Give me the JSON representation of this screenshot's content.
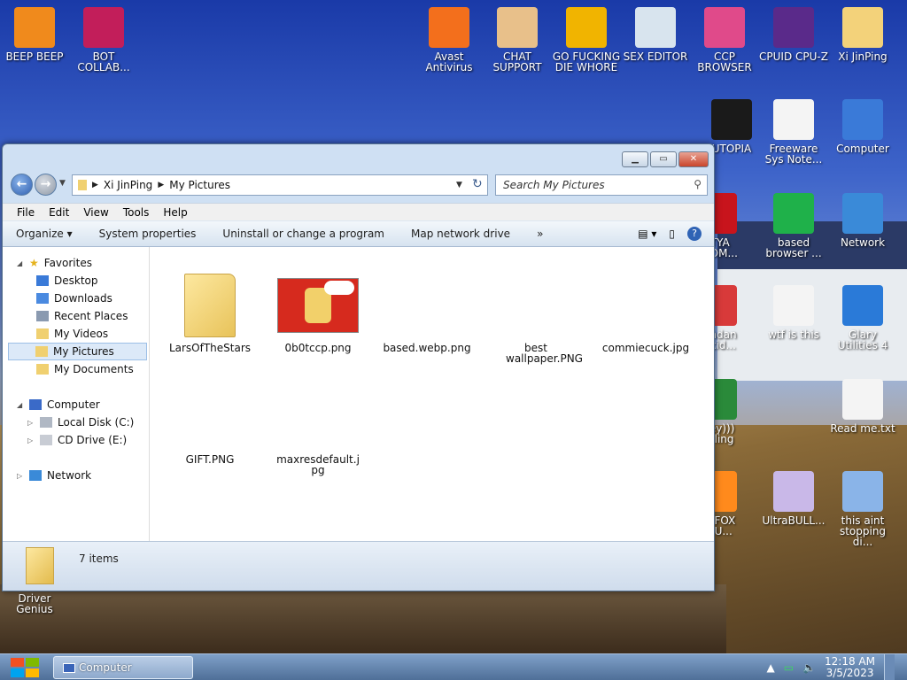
{
  "desktop": {
    "icons": [
      {
        "label": "BEEP BEEP",
        "icon": "vlc-cone-icon",
        "color": "#f08a1c"
      },
      {
        "label": "BOT COLLAB...",
        "icon": "monitor-app-icon",
        "color": "#c21e5a"
      },
      {
        "label": "Avast Antivirus",
        "icon": "avast-icon",
        "color": "#f36f1c"
      },
      {
        "label": "CHAT SUPPORT",
        "icon": "support-person-icon",
        "color": "#e8c08a"
      },
      {
        "label": "GO FUCKING DIE WHORE",
        "icon": "de-logo-icon",
        "color": "#f1b400"
      },
      {
        "label": "SEX EDITOR",
        "icon": "hex-editor-icon",
        "color": "#d8e4ee"
      },
      {
        "label": "CCP BROWSER",
        "icon": "browser-orb-icon",
        "color": "#e04a8a"
      },
      {
        "label": "CPUID CPU-Z",
        "icon": "cpuz-icon",
        "color": "#5a2a8a"
      },
      {
        "label": "Xi JinPing",
        "icon": "user-folder-icon",
        "color": "#f3d27a"
      },
      {
        "label": "UTOPIA",
        "icon": "utopia-icon",
        "color": "#1a1a1a"
      },
      {
        "label": "Freeware Sys Note...",
        "icon": "document-icon",
        "color": "#f4f4f4"
      },
      {
        "label": "Computer",
        "icon": "computer-icon",
        "color": "#3a7ad8"
      },
      {
        "label": "based browser ...",
        "icon": "green-chat-icon",
        "color": "#1fb14a"
      },
      {
        "label": "Network",
        "icon": "network-globe-icon",
        "color": "#3a8ad8"
      },
      {
        "label": "wtf is this",
        "icon": "calendar-file-icon",
        "color": "#f4f4f4"
      },
      {
        "label": "Glary Utilities 4",
        "icon": "glary-icon",
        "color": "#2a7ad8"
      },
      {
        "label": "Read me.txt",
        "icon": "text-file-icon",
        "color": "#f4f4f4"
      },
      {
        "label": "UltraBULL...",
        "icon": "disc-icon",
        "color": "#c9b8e8"
      },
      {
        "label": "this aint stopping di...",
        "icon": "pc-repair-icon",
        "color": "#8ab4e8"
      },
      {
        "label": "ETYA NSOM...",
        "icon": "skull-icon",
        "color": "#c8141c"
      },
      {
        "label": "bandan nocid...",
        "icon": "rage-face-icon",
        "color": "#d83a3a"
      },
      {
        "label": "they))) owling",
        "icon": "santa-icon",
        "color": "#2a8a3a"
      },
      {
        "label": "RY FOX JWU...",
        "icon": "firefox-icon",
        "color": "#ff8a1c"
      },
      {
        "label": "Driver Genius",
        "icon": "driver-icon",
        "color": "#2a8a3a"
      }
    ]
  },
  "window": {
    "title": "My Pictures",
    "address": {
      "crumbs": [
        "Xi JinPing",
        "My Pictures"
      ]
    },
    "search_placeholder": "Search My Pictures",
    "menu": [
      "File",
      "Edit",
      "View",
      "Tools",
      "Help"
    ],
    "toolbar": [
      "Organize",
      "System properties",
      "Uninstall or change a program",
      "Map network drive"
    ],
    "toolbar_more": "»",
    "nav": {
      "favorites": "Favorites",
      "fav_items": [
        "Desktop",
        "Downloads",
        "Recent Places",
        "My Videos",
        "My Pictures",
        "My Documents"
      ],
      "computer": "Computer",
      "computer_items": [
        "Local Disk (C:)",
        "CD Drive (E:)"
      ],
      "network": "Network"
    },
    "files": [
      {
        "name": "LarsOfTheStars",
        "type": "folder"
      },
      {
        "name": "0b0tccp.png",
        "type": "image"
      },
      {
        "name": "based.webp.png",
        "type": "blank"
      },
      {
        "name": "best wallpaper.PNG",
        "type": "blank"
      },
      {
        "name": "commiecuck.jpg",
        "type": "blank"
      },
      {
        "name": "GIFT.PNG",
        "type": "blank"
      },
      {
        "name": "maxresdefault.jpg",
        "type": "blank"
      }
    ],
    "status": "7 items"
  },
  "taskbar": {
    "task_label": "Computer",
    "time": "12:18 AM",
    "date": "3/5/2023"
  }
}
